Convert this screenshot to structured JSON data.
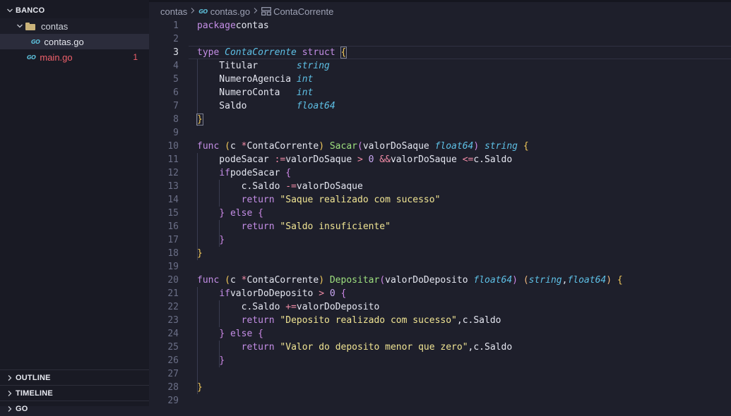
{
  "explorer": {
    "section_title": "BANCO",
    "folder": "contas",
    "files": [
      {
        "name": "contas.go",
        "icon": "go-file-icon",
        "selected": true
      },
      {
        "name": "main.go",
        "icon": "go-file-icon",
        "errors": "1",
        "error_color": "#f0606b"
      }
    ],
    "outline_title": "OUTLINE",
    "timeline_title": "TIMELINE",
    "go_title": "GO"
  },
  "breadcrumb": {
    "folder": "contas",
    "file": "contas.go",
    "symbol": "ContaCorrente"
  },
  "go_badge": "GO",
  "editor": {
    "active_line": 3,
    "line_numbers": [
      "1",
      "2",
      "3",
      "4",
      "5",
      "6",
      "7",
      "8",
      "9",
      "10",
      "11",
      "12",
      "13",
      "14",
      "15",
      "16",
      "17",
      "18",
      "19",
      "20",
      "21",
      "22",
      "23",
      "24",
      "25",
      "26",
      "27",
      "28",
      "29"
    ],
    "lines": [
      [
        [
          "k",
          "package"
        ],
        [
          "",
          "contas"
        ]
      ],
      [],
      [
        [
          "k",
          "type"
        ],
        [
          "",
          ""
        ],
        [
          "t",
          "ContaCorrente"
        ],
        [
          "",
          ""
        ],
        [
          "k",
          "struct"
        ],
        [
          "",
          ""
        ],
        [
          "b bm",
          "{"
        ]
      ],
      [
        [
          "",
          "    Titular       "
        ],
        [
          "t",
          "string"
        ]
      ],
      [
        [
          "",
          "    NumeroAgencia "
        ],
        [
          "t",
          "int"
        ]
      ],
      [
        [
          "",
          "    NumeroConta   "
        ],
        [
          "t",
          "int"
        ]
      ],
      [
        [
          "",
          "    Saldo         "
        ],
        [
          "t",
          "float64"
        ]
      ],
      [
        [
          "b bm",
          "}"
        ]
      ],
      [],
      [
        [
          "k",
          "func"
        ],
        [
          "",
          ""
        ],
        [
          "b",
          "("
        ],
        [
          "",
          "c "
        ],
        [
          "o",
          "*"
        ],
        [
          "",
          "ContaCorrente"
        ],
        [
          "b",
          ")"
        ],
        [
          "",
          ""
        ],
        [
          "f",
          "Sacar"
        ],
        [
          "b2",
          "("
        ],
        [
          "",
          "valorDoSaque "
        ],
        [
          "t",
          "float64"
        ],
        [
          "b2",
          ")"
        ],
        [
          "",
          ""
        ],
        [
          "t",
          "string"
        ],
        [
          "",
          ""
        ],
        [
          "b",
          "{"
        ]
      ],
      [
        [
          "",
          "    podeSacar "
        ],
        [
          "o",
          ":="
        ],
        [
          "",
          "valorDoSaque "
        ],
        [
          "o",
          ">"
        ],
        [
          "",
          ""
        ],
        [
          "n",
          "0"
        ],
        [
          "",
          ""
        ],
        [
          "o",
          "&&"
        ],
        [
          "",
          "valorDoSaque "
        ],
        [
          "o",
          "<="
        ],
        [
          "",
          "c.Saldo"
        ]
      ],
      [
        [
          "",
          "    "
        ],
        [
          "k",
          "if"
        ],
        [
          "",
          "podeSacar "
        ],
        [
          "b2",
          "{"
        ]
      ],
      [
        [
          "",
          "        c.Saldo "
        ],
        [
          "o",
          "-="
        ],
        [
          "",
          "valorDoSaque"
        ]
      ],
      [
        [
          "",
          "        "
        ],
        [
          "k",
          "return"
        ],
        [
          "",
          ""
        ],
        [
          "s",
          "\"Saque realizado com sucesso\""
        ]
      ],
      [
        [
          "",
          "    "
        ],
        [
          "b2",
          "}"
        ],
        [
          "",
          ""
        ],
        [
          "k",
          "else"
        ],
        [
          "",
          ""
        ],
        [
          "b2",
          "{"
        ]
      ],
      [
        [
          "",
          "        "
        ],
        [
          "k",
          "return"
        ],
        [
          "",
          ""
        ],
        [
          "s",
          "\"Saldo insuficiente\""
        ]
      ],
      [
        [
          "",
          "    "
        ],
        [
          "b2",
          "}"
        ]
      ],
      [
        [
          "b",
          "}"
        ]
      ],
      [],
      [
        [
          "k",
          "func"
        ],
        [
          "",
          ""
        ],
        [
          "b",
          "("
        ],
        [
          "",
          "c "
        ],
        [
          "o",
          "*"
        ],
        [
          "",
          "ContaCorrente"
        ],
        [
          "b",
          ")"
        ],
        [
          "",
          ""
        ],
        [
          "f",
          "Depositar"
        ],
        [
          "b2",
          "("
        ],
        [
          "",
          "valorDoDeposito "
        ],
        [
          "t",
          "float64"
        ],
        [
          "b2",
          ")"
        ],
        [
          "",
          ""
        ],
        [
          "p",
          "("
        ],
        [
          "t",
          "string"
        ],
        [
          "",
          ","
        ],
        [
          "t",
          "float64"
        ],
        [
          "p",
          ")"
        ],
        [
          "",
          ""
        ],
        [
          "b",
          "{"
        ]
      ],
      [
        [
          "",
          "    "
        ],
        [
          "k",
          "if"
        ],
        [
          "",
          "valorDoDeposito "
        ],
        [
          "o",
          ">"
        ],
        [
          "",
          ""
        ],
        [
          "n",
          "0"
        ],
        [
          "",
          ""
        ],
        [
          "b2",
          "{"
        ]
      ],
      [
        [
          "",
          "        c.Saldo "
        ],
        [
          "o",
          "+="
        ],
        [
          "",
          "valorDoDeposito"
        ]
      ],
      [
        [
          "",
          "        "
        ],
        [
          "k",
          "return"
        ],
        [
          "",
          ""
        ],
        [
          "s",
          "\"Deposito realizado com sucesso\""
        ],
        [
          "",
          ","
        ],
        [
          "",
          "c.Saldo"
        ]
      ],
      [
        [
          "",
          "    "
        ],
        [
          "b2",
          "}"
        ],
        [
          "",
          ""
        ],
        [
          "k",
          "else"
        ],
        [
          "",
          ""
        ],
        [
          "b2",
          "{"
        ]
      ],
      [
        [
          "",
          "        "
        ],
        [
          "k",
          "return"
        ],
        [
          "",
          ""
        ],
        [
          "s",
          "\"Valor do deposito menor que zero\""
        ],
        [
          "",
          ","
        ],
        [
          "",
          "c.Saldo"
        ]
      ],
      [
        [
          "",
          "    "
        ],
        [
          "b2",
          "}"
        ]
      ],
      [],
      [
        [
          "b",
          "}"
        ]
      ],
      []
    ]
  }
}
